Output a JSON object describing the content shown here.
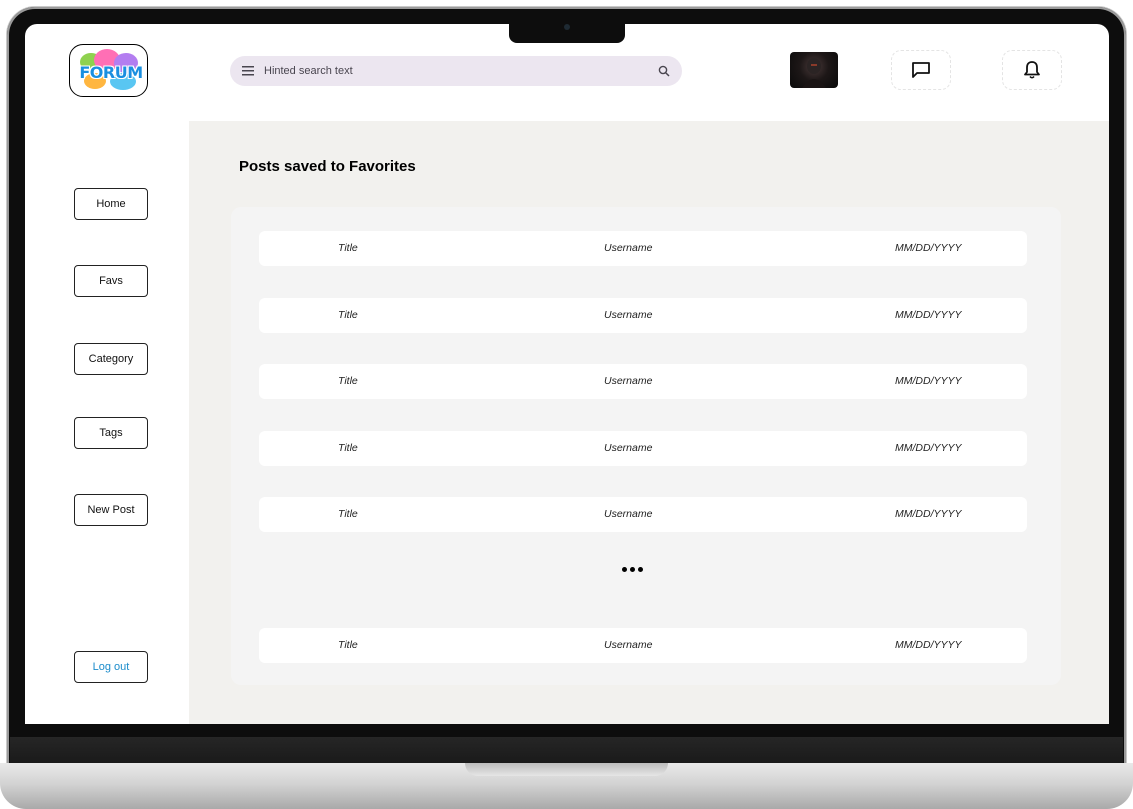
{
  "header": {
    "logo_text": "FORUM",
    "search": {
      "placeholder": "Hinted search text"
    }
  },
  "sidebar": {
    "items": [
      {
        "label": "Home"
      },
      {
        "label": "Favs"
      },
      {
        "label": "Category"
      },
      {
        "label": "Tags"
      },
      {
        "label": "New Post"
      }
    ],
    "logout_label": "Log out"
  },
  "main": {
    "title": "Posts saved to Favorites",
    "rows": [
      {
        "title": "Title",
        "username": "Username",
        "date": "MM/DD/YYYY"
      },
      {
        "title": "Title",
        "username": "Username",
        "date": "MM/DD/YYYY"
      },
      {
        "title": "Title",
        "username": "Username",
        "date": "MM/DD/YYYY"
      },
      {
        "title": "Title",
        "username": "Username",
        "date": "MM/DD/YYYY"
      },
      {
        "title": "Title",
        "username": "Username",
        "date": "MM/DD/YYYY"
      },
      {
        "title": "Title",
        "username": "Username",
        "date": "MM/DD/YYYY"
      }
    ]
  },
  "colors": {
    "search_bg": "#ece6f0",
    "main_bg": "#f2f1ee",
    "logout_text": "#1b8ccb",
    "logo_text": "#1a8fe0"
  },
  "icons": [
    "menu-icon",
    "search-icon",
    "chat-icon",
    "bell-icon",
    "more-dots-icon"
  ]
}
